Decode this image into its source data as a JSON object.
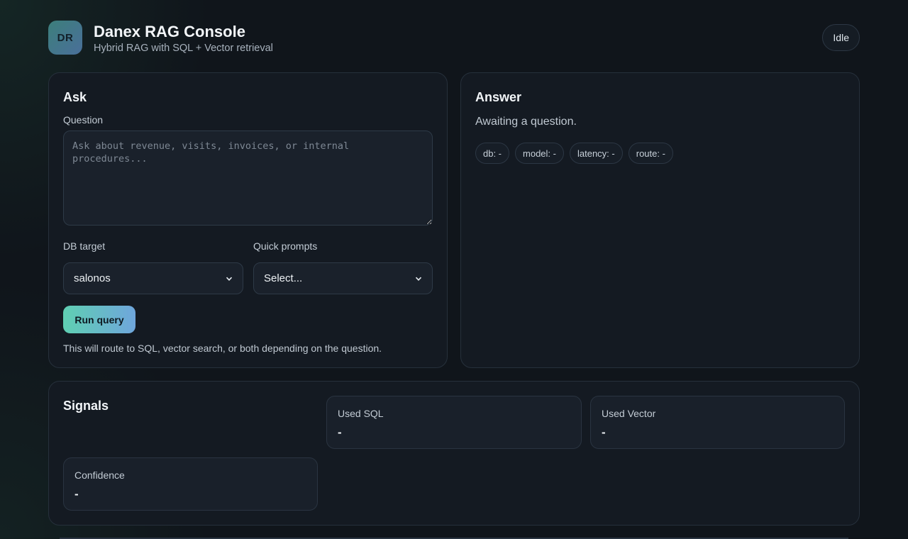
{
  "header": {
    "logo_text": "DR",
    "title": "Danex RAG Console",
    "subtitle": "Hybrid RAG with SQL + Vector retrieval",
    "status": "Idle"
  },
  "ask": {
    "title": "Ask",
    "question_label": "Question",
    "question_value": "",
    "question_placeholder": "Ask about revenue, visits, invoices, or internal procedures...",
    "db_label": "DB target",
    "db_selected": "salonos",
    "prompts_label": "Quick prompts",
    "prompts_selected": "Select...",
    "run_label": "Run query",
    "hint": "This will route to SQL, vector search, or both depending on the question."
  },
  "answer": {
    "title": "Answer",
    "text": "Awaiting a question.",
    "chips": [
      "db: -",
      "model: -",
      "latency: -",
      "route: -"
    ]
  },
  "signals": {
    "title": "Signals",
    "used_sql_label": "Used SQL",
    "used_sql_value": "-",
    "used_vector_label": "Used Vector",
    "used_vector_value": "-",
    "confidence_label": "Confidence",
    "confidence_value": "-"
  },
  "icons": {
    "select_chevron": "chevron-down-icon"
  }
}
